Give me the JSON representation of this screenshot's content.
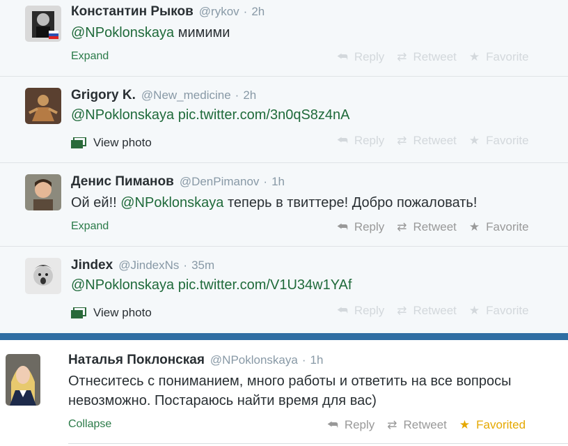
{
  "tweets": [
    {
      "name": "Константин Рыков",
      "handle": "@rykov",
      "time": "2h",
      "mention": "@NPoklonskaya",
      "rest": " мимими",
      "link": "",
      "footer": "Expand",
      "reply": "Reply",
      "retweet": "Retweet",
      "favorite": "Favorite"
    },
    {
      "name": "Grigory K.",
      "handle": "@New_medicine",
      "time": "2h",
      "mention": "@NPoklonskaya",
      "rest": "",
      "link": "pic.twitter.com/3n0qS8z4nA",
      "footer": "View photo",
      "reply": "Reply",
      "retweet": "Retweet",
      "favorite": "Favorite"
    },
    {
      "name": "Денис Пиманов",
      "handle": "@DenPimanov",
      "time": "1h",
      "pre": "Ой ей!! ",
      "mention": "@NPoklonskaya",
      "rest": " теперь в твиттере! Добро пожаловать!",
      "link": "",
      "footer": "Expand",
      "reply": "Reply",
      "retweet": "Retweet",
      "favorite": "Favorite"
    },
    {
      "name": "Jindex",
      "handle": "@JindexNs",
      "time": "35m",
      "mention": "@NPoklonskaya",
      "rest": "",
      "link": "pic.twitter.com/V1U34w1YAf",
      "footer": "View photo",
      "reply": "Reply",
      "retweet": "Retweet",
      "favorite": "Favorite"
    },
    {
      "name": "Наталья Поклонская",
      "handle": "@NPoklonskaya",
      "time": "1h",
      "line1": "Отнеситесь с пониманием, много работы и ответить на все вопросы",
      "line2": "невозможно. Постараюсь найти время для вас)",
      "footer": "Collapse",
      "reply": "Reply",
      "retweet": "Retweet",
      "favorite": "Favorited"
    }
  ],
  "separator": "·",
  "icons": {
    "reply": "reply-icon",
    "retweet": "retweet-icon",
    "favorite": "star-icon",
    "photo": "photo-icon"
  },
  "colors": {
    "link_green": "#1f6a3a",
    "favorited": "#e5a800",
    "thread_bar": "#2f6ea3"
  }
}
